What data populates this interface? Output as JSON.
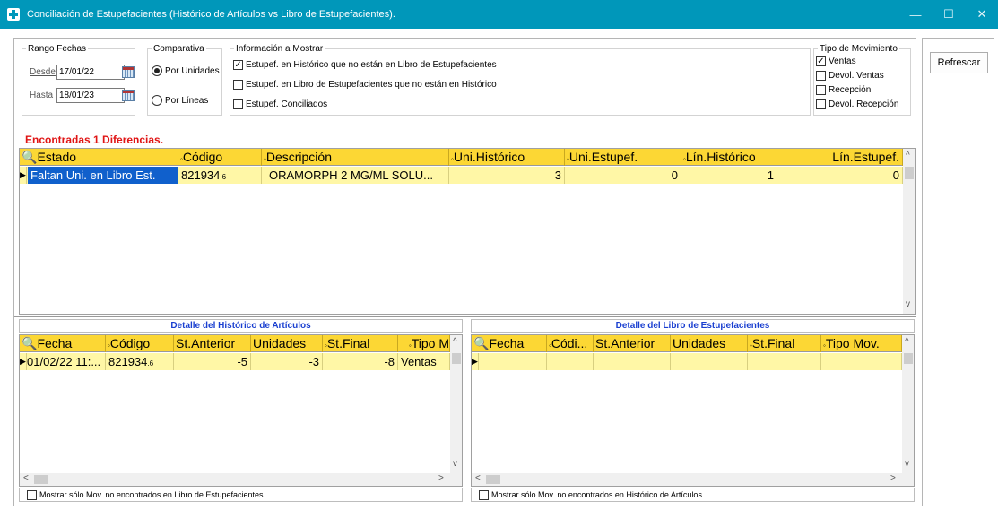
{
  "window": {
    "title": "Conciliación de Estupefacientes (Histórico de Artículos  vs  Libro de Estupefacientes).",
    "min_glyph": "—",
    "max_glyph": "☐",
    "close_glyph": "✕"
  },
  "filters": {
    "rango_label": "Rango Fechas",
    "desde_label": "Desde",
    "desde_value": "17/01/22",
    "hasta_label": "Hasta",
    "hasta_value": "18/01/23",
    "comparativa_label": "Comparativa",
    "por_unidades": "Por Unidades",
    "por_lineas": "Por Líneas",
    "info_label": "Información a Mostrar",
    "info_opt1": "Estupef. en Histórico que no están en Libro de Estupefacientes",
    "info_opt2": "Estupef. en Libro de Estupefacientes que no están en Histórico",
    "info_opt3": "Estupef. Conciliados",
    "tipo_label": "Tipo de Movimiento",
    "tipo_ventas": "Ventas",
    "tipo_devol_ventas": "Devol. Ventas",
    "tipo_recepcion": "Recepción",
    "tipo_devol_recepcion": "Devol. Recepción",
    "check_glyph": "✓"
  },
  "found_text": "Encontradas 1 Diferencias.",
  "main_grid": {
    "headers": [
      "Estado",
      "Código",
      "Descripción",
      "Uni.Histórico",
      "Uni.Estupef.",
      "Lín.Histórico",
      "Lín.Estupef."
    ],
    "row": {
      "estado": "Faltan Uni. en Libro Est.",
      "codigo": "821934",
      "codigo_suffix": ".6",
      "descripcion": "ORAMORPH 2 MG/ML SOLU...",
      "uni_historico": "3",
      "uni_estupef": "0",
      "lin_historico": "1",
      "lin_estupef": "0"
    }
  },
  "hist_section": {
    "title": "Detalle del Histórico de Artículos",
    "headers": [
      "Fecha",
      "Código",
      "St.Anterior",
      "Unidades",
      "St.Final",
      "Tipo M"
    ],
    "row": {
      "fecha": "01/02/22 11:...",
      "codigo": "821934",
      "codigo_suffix": ".6",
      "st_anterior": "-5",
      "unidades": "-3",
      "st_final": "-8",
      "tipo": "Ventas"
    },
    "filter_label": "Mostrar sólo Mov. no encontrados en Libro de Estupefacientes"
  },
  "libro_section": {
    "title": "Detalle del Libro de Estupefacientes",
    "headers": [
      "Fecha",
      "Códi...",
      "St.Anterior",
      "Unidades",
      "St.Final",
      "Tipo Mov."
    ],
    "filter_label": "Mostrar sólo Mov. no encontrados en Histórico de Artículos"
  },
  "buttons": {
    "refresh": "Refrescar"
  }
}
